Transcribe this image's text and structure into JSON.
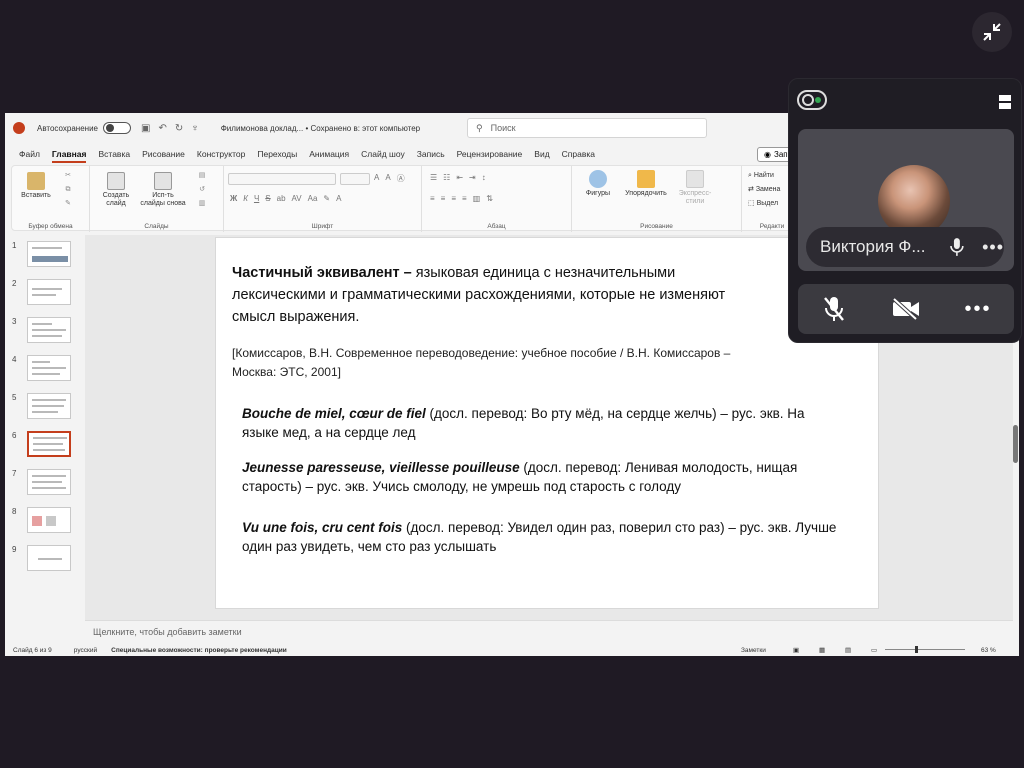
{
  "ppt": {
    "titlebar": {
      "autosave_label": "Автосохранение",
      "doc_title": "Филимонова доклад... • Сохранено в: этот компьютер",
      "search_placeholder": "Поиск"
    },
    "tabs": [
      "Файл",
      "Главная",
      "Вставка",
      "Рисование",
      "Конструктор",
      "Переходы",
      "Анимация",
      "Слайд шоу",
      "Запись",
      "Рецензирование",
      "Вид",
      "Справка"
    ],
    "active_tab": "Главная",
    "record_label": "Зап",
    "ribbon": {
      "paste": "Вставить",
      "new_slide": "Создать слайд",
      "reuse_slides": "Исп-ть слайды снова",
      "shapes": "Фигуры",
      "arrange": "Упорядочить",
      "express_styles": "Экспресс-стили",
      "find": "Найти",
      "replace": "Замена",
      "select": "Выдел",
      "groups": {
        "clipboard": "Буфер обмена",
        "slides": "Слайды",
        "font": "Шрифт",
        "paragraph": "Абзац",
        "drawing": "Рисование",
        "editing": "Редакти"
      }
    },
    "thumbnail_numbers": [
      "1",
      "2",
      "3",
      "4",
      "5",
      "6",
      "7",
      "8",
      "9"
    ],
    "selected_slide": 6,
    "slide": {
      "p1_bold": "Частичный эквивалент –",
      "p1_rest": " языковая единица с незначительными лексическими и грамматическими расхождениями, которые не изменяют смысл выражения.",
      "p2": "[Комиссаров, В.Н. Современное переводоведение: учебное пособие / В.Н. Комиссаров – Москва: ЭТС, 2001]",
      "examples": [
        {
          "phrase": "Bouche de miel, cœur de fiel",
          "rest": " (досл. перевод: Во рту мёд, на сердце желчь) – рус. экв. На языке мед, а на сердце лед"
        },
        {
          "phrase": "Jeunesse paresseuse, vieillesse pouilleuse",
          "rest": " (досл. перевод: Ленивая молодость, нищая старость) – рус. экв. Учись смолоду, не умрешь под старость с голоду"
        },
        {
          "phrase": "Vu une fois, cru cent fois",
          "rest": " (досл. перевод: Увидел один раз, поверил сто раз) – рус. экв. Лучше один раз увидеть, чем сто раз услышать"
        }
      ]
    },
    "notes_placeholder": "Щелкните, чтобы добавить заметки",
    "status": {
      "slide_count": "Слайд 6 из 9",
      "language": "русский",
      "accessibility": "Специальные возможности: проверьте рекомендации",
      "notes_btn": "Заметки",
      "zoom": "63 %"
    }
  },
  "call": {
    "participant_name": "Виктория Ф..."
  },
  "colors": {
    "accent": "#c43e1c",
    "call_bg": "#1f1d24"
  }
}
